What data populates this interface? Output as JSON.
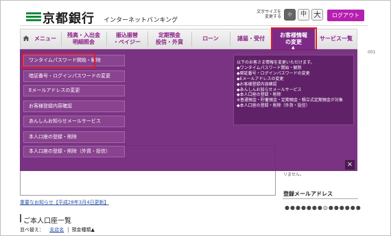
{
  "header": {
    "bank_name": "京都銀行",
    "service_name": "インターネットバンキング",
    "font_size_label_line1": "文字サイズを",
    "font_size_label_line2": "変更する",
    "font_size_small": "小",
    "font_size_medium": "中",
    "font_size_large": "大",
    "logout_label": "ログアウト"
  },
  "nav": {
    "items": [
      {
        "label": "メニュー"
      },
      {
        "label": "残高・入出金\n明細照会"
      },
      {
        "label": "振込振替\n・ペイジー"
      },
      {
        "label": "定期預金\n投信・外貨"
      },
      {
        "label": "ローン"
      },
      {
        "label": "諸届・受付"
      },
      {
        "label": "お客様情報\nの変更"
      },
      {
        "label": "サービス一覧"
      }
    ],
    "active_index": 6
  },
  "dropdown": {
    "items": [
      {
        "label": "ワンタイムパスワード開始・解除"
      },
      {
        "label": "暗証番号・ログインパスワードの変更"
      },
      {
        "label": "Eメールアドレスの変更"
      },
      {
        "label": "お客様登録内容確認"
      },
      {
        "label": "あんしんお知らせメールサービス"
      },
      {
        "label": "本人口座の登録・削除"
      },
      {
        "label": "本人口座の登録・削除（外貨・投信）"
      }
    ],
    "info_text": "以下のお客さま情報を変更いただけます。\n◆ワンタイムパスワード開始・解除\n◆暗証番号・ログインパスワードの変更\n◆Eメールアドレスの変更\n◆お客様登録内容確認\n◆あんしんお知らせメールサービス\n◆本人口座の登録・削除\n※普通預金・貯蓄預金・定期預金・積立式定期預金が対象\n◆本人口座の登録・削除（外貨・投信）",
    "close_label": "×"
  },
  "page": {
    "right_fragment": "001",
    "notice_link": "重要なお知らせ【平成28年3月4日更新】",
    "list_title": "ご本人口座一覧",
    "sort_label": "並べ替え：",
    "sort_branch": "支店名",
    "sort_type": "預金種類▲",
    "right_text": "リません。",
    "mail_title": "登録メールアドレス",
    "masked_email": "●●●●●●●◎●●●●●●"
  },
  "colors": {
    "brand_green": "#148a3c",
    "accent_purple": "#7c2a86",
    "logout_magenta": "#b520b0",
    "highlight_red": "#e01c2a"
  }
}
